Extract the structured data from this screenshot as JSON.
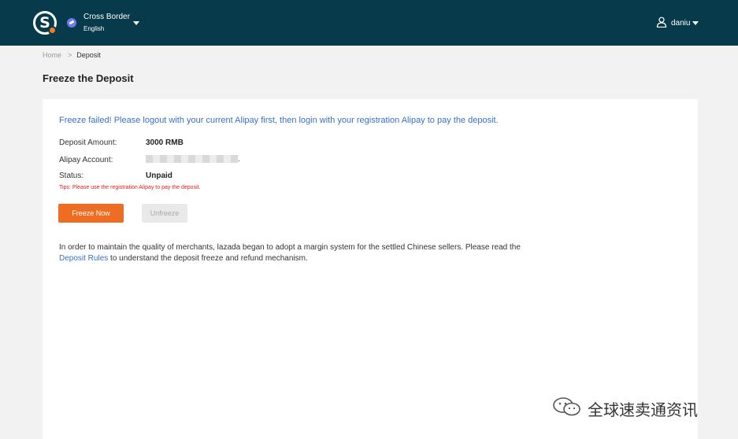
{
  "header": {
    "logo_letter": "S",
    "region": {
      "name": "Cross Border",
      "language": "English"
    },
    "user": {
      "name": "daniu"
    }
  },
  "breadcrumb": {
    "home": "Home",
    "current": "Deposit"
  },
  "page": {
    "title": "Freeze the Deposit"
  },
  "deposit": {
    "error_message": "Freeze failed! Please logout with your current Alipay first, then login with your registration Alipay to pay the deposit.",
    "amount_label": "Deposit Amount:",
    "amount_value": "3000 RMB",
    "account_label": "Alipay Account:",
    "account_suffix": ".",
    "status_label": "Status:",
    "status_value": "Unpaid",
    "tips": "Tips: Please use the registration Alipay to pay the deposit.",
    "freeze_button": "Freeze Now",
    "unfreeze_button": "Unfreeze",
    "info_before": "In order to maintain the quality of merchants, lazada began to adopt a margin system for the settled Chinese sellers. Please read the ",
    "info_link": "Deposit Rules",
    "info_after": " to understand the deposit freeze and refund mechanism."
  },
  "watermark": {
    "text": "全球速卖通资讯"
  },
  "colors": {
    "header_bg": "#073b4c",
    "accent": "#ef6d22",
    "link": "#3b6fc8",
    "error": "#e02020"
  }
}
